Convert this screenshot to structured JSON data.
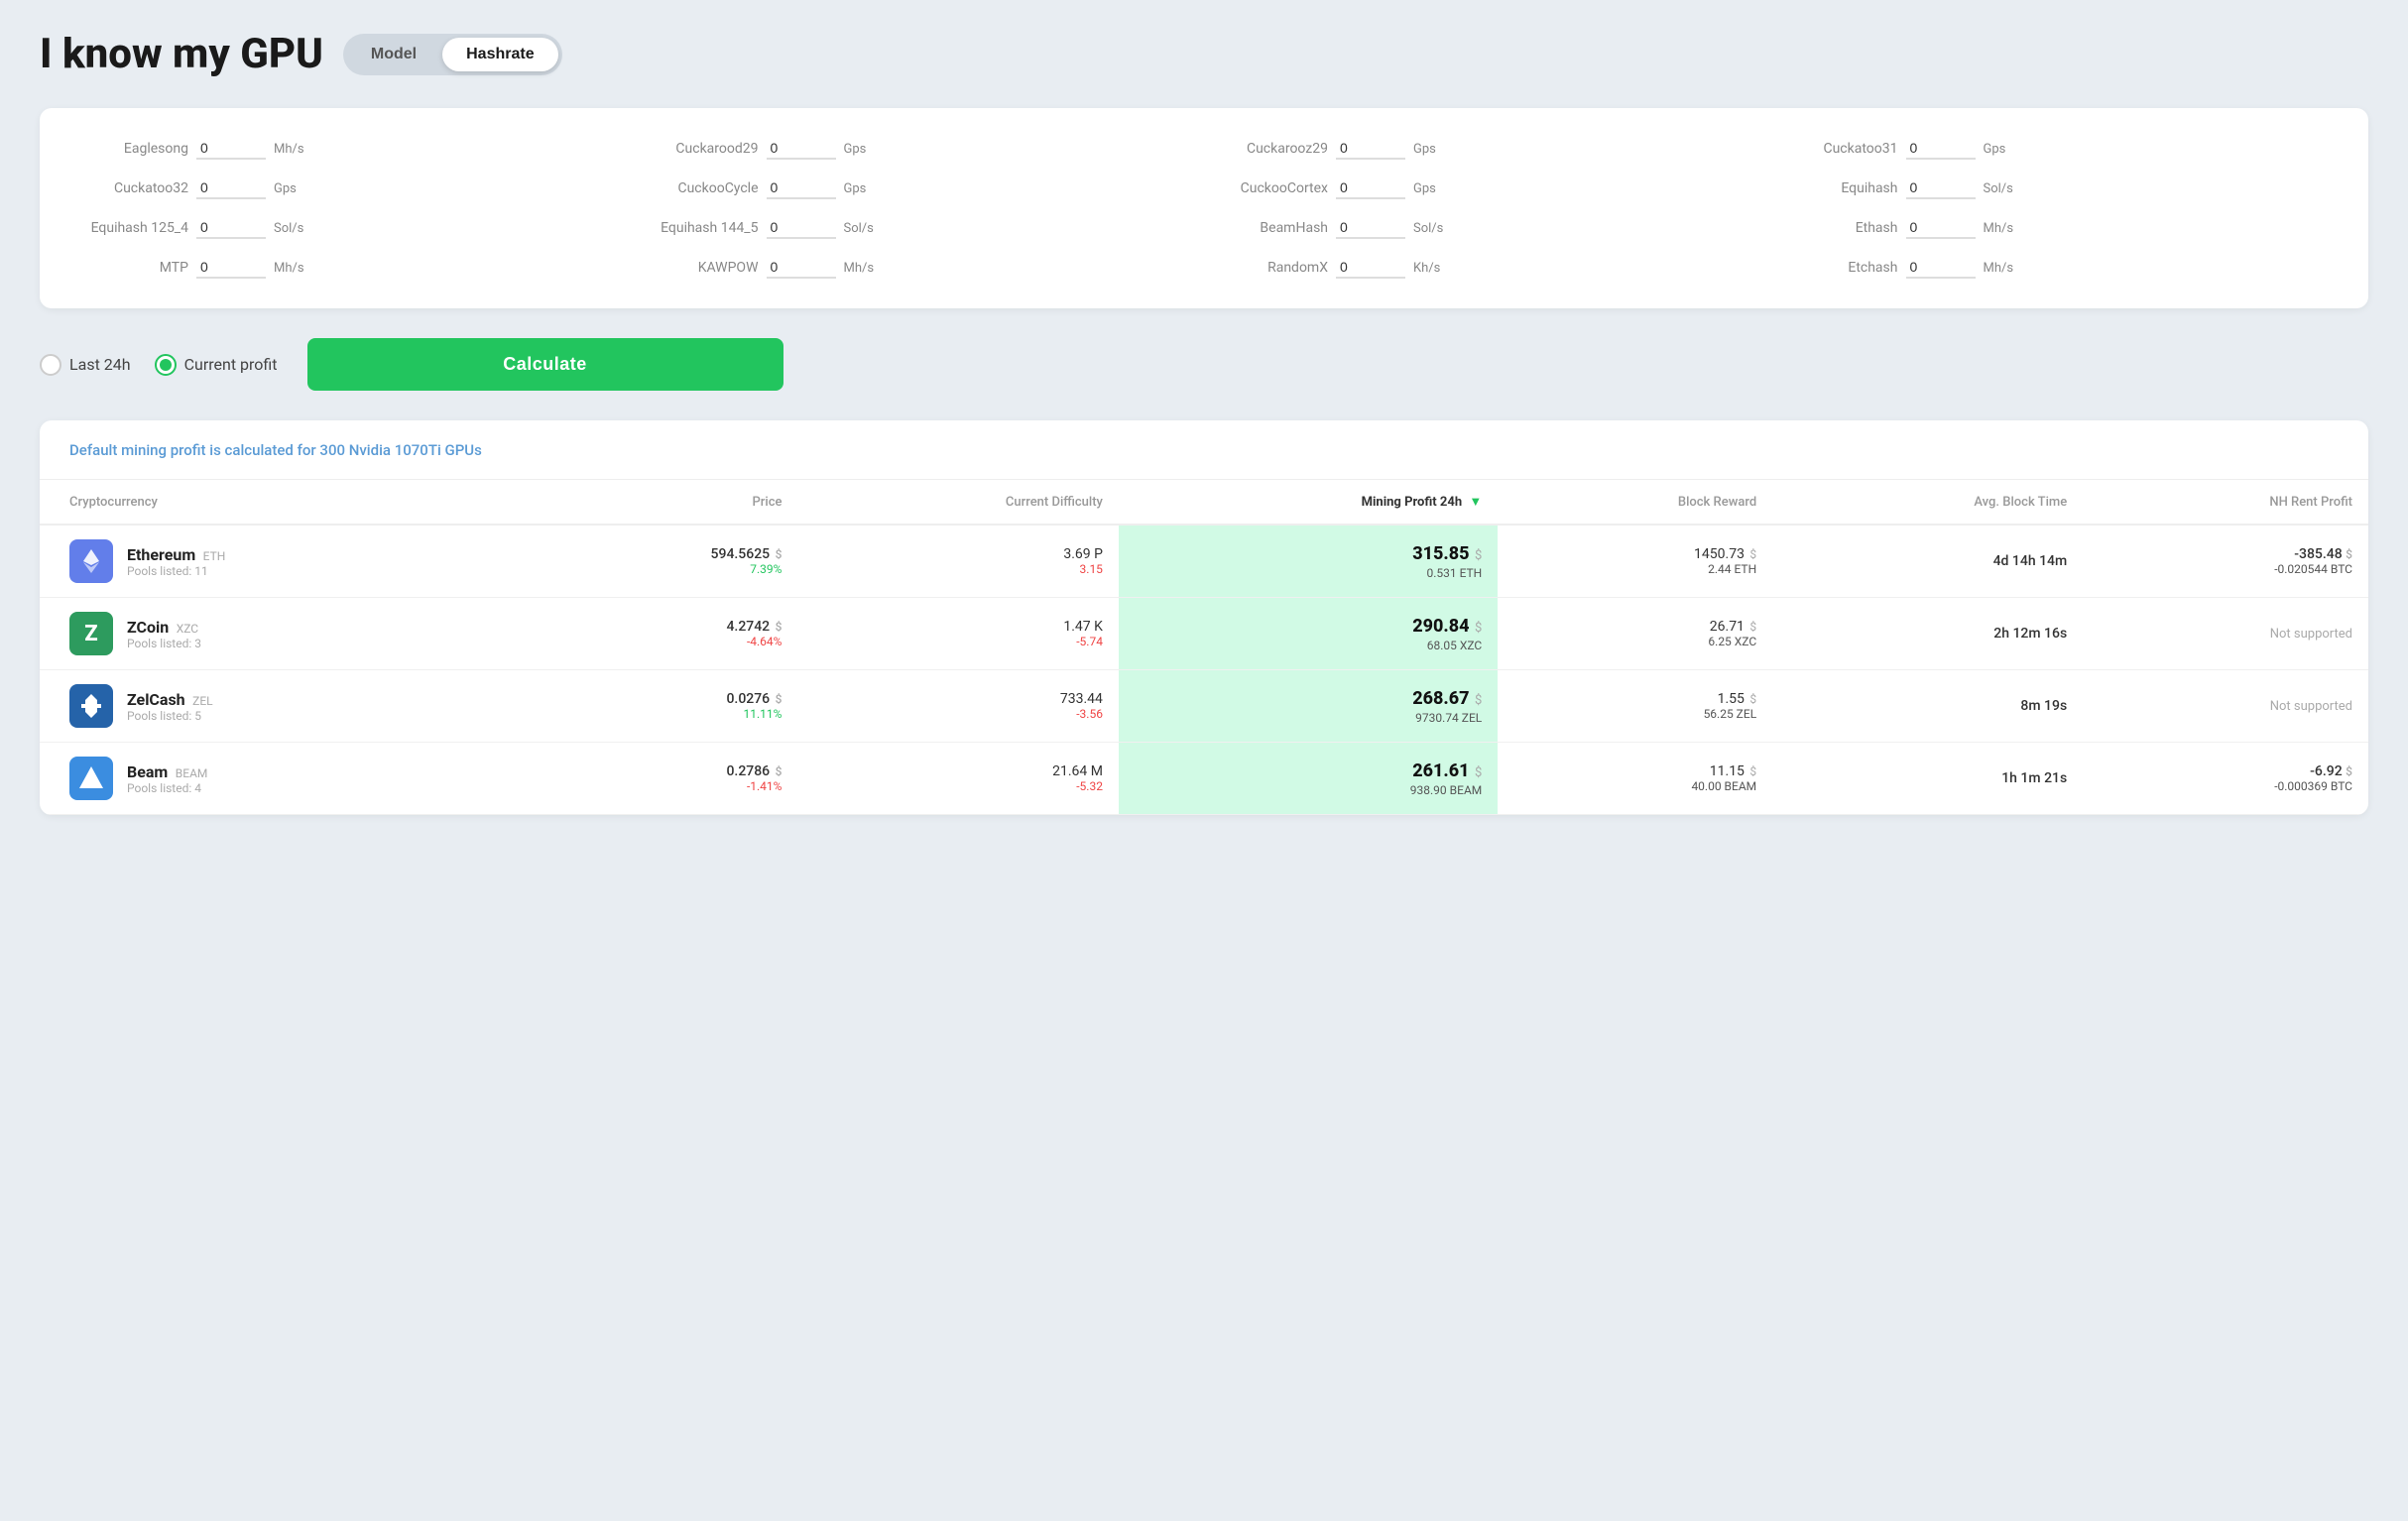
{
  "header": {
    "title": "I know my GPU",
    "toggle": {
      "model_label": "Model",
      "hashrate_label": "Hashrate",
      "active": "hashrate"
    }
  },
  "hashrate_panel": {
    "fields": [
      {
        "label": "Eaglesong",
        "value": "0",
        "unit": "Mh/s"
      },
      {
        "label": "Cuckarood29",
        "value": "0",
        "unit": "Gps"
      },
      {
        "label": "Cuckarooz29",
        "value": "0",
        "unit": "Gps"
      },
      {
        "label": "Cuckatoo31",
        "value": "0",
        "unit": "Gps"
      },
      {
        "label": "Cuckatoo32",
        "value": "0",
        "unit": "Gps"
      },
      {
        "label": "CuckooCycle",
        "value": "0",
        "unit": "Gps"
      },
      {
        "label": "CuckooCortex",
        "value": "0",
        "unit": "Gps"
      },
      {
        "label": "Equihash",
        "value": "0",
        "unit": "Sol/s"
      },
      {
        "label": "Equihash 125_4",
        "value": "0",
        "unit": "Sol/s"
      },
      {
        "label": "Equihash 144_5",
        "value": "0",
        "unit": "Sol/s"
      },
      {
        "label": "BeamHash",
        "value": "0",
        "unit": "Sol/s"
      },
      {
        "label": "Ethash",
        "value": "0",
        "unit": "Mh/s"
      },
      {
        "label": "MTP",
        "value": "0",
        "unit": "Mh/s"
      },
      {
        "label": "KAWPOW",
        "value": "0",
        "unit": "Mh/s"
      },
      {
        "label": "RandomX",
        "value": "0",
        "unit": "Kh/s"
      },
      {
        "label": "Etchash",
        "value": "0",
        "unit": "Mh/s"
      }
    ]
  },
  "controls": {
    "last24h_label": "Last 24h",
    "current_profit_label": "Current profit",
    "selected": "current_profit",
    "calculate_label": "Calculate"
  },
  "results": {
    "info_text": "Default mining profit is calculated for 300 Nvidia 1070Ti GPUs",
    "columns": {
      "cryptocurrency": "Cryptocurrency",
      "price": "Price",
      "current_difficulty": "Current Difficulty",
      "mining_profit": "Mining Profit 24h",
      "block_reward": "Block Reward",
      "avg_block_time": "Avg. Block Time",
      "nh_rent_profit": "NH Rent Profit"
    },
    "rows": [
      {
        "icon": "♦",
        "icon_bg": "#627EEA",
        "icon_color": "white",
        "name": "Ethereum",
        "ticker": "ETH",
        "pools": "Pools listed: 11",
        "price_main": "594.5625",
        "price_pct": "7.39%",
        "price_pct_positive": true,
        "diff_main": "3.69 P",
        "diff_sub": "3.15",
        "diff_sub_negative": true,
        "profit_main": "315.85",
        "profit_sub": "0.531 ETH",
        "reward_main": "1450.73",
        "reward_sub": "2.44 ETH",
        "block_time": "4d 14h 14m",
        "nh_main": "-385.48",
        "nh_sub": "-0.020544 BTC",
        "nh_positive": false,
        "not_supported": false
      },
      {
        "icon": "Z",
        "icon_bg": "#2D9B5E",
        "icon_color": "white",
        "name": "ZCoin",
        "ticker": "XZC",
        "pools": "Pools listed: 3",
        "price_main": "4.2742",
        "price_pct": "-4.64%",
        "price_pct_positive": false,
        "diff_main": "1.47 K",
        "diff_sub": "-5.74",
        "diff_sub_negative": true,
        "profit_main": "290.84",
        "profit_sub": "68.05 XZC",
        "reward_main": "26.71",
        "reward_sub": "6.25 XZC",
        "block_time": "2h 12m 16s",
        "nh_main": "",
        "nh_sub": "",
        "nh_positive": false,
        "not_supported": true
      },
      {
        "icon": "⬡",
        "icon_bg": "#2563A9",
        "icon_color": "white",
        "name": "ZelCash",
        "ticker": "ZEL",
        "pools": "Pools listed: 5",
        "price_main": "0.0276",
        "price_pct": "11.11%",
        "price_pct_positive": true,
        "diff_main": "733.44",
        "diff_sub": "-3.56",
        "diff_sub_negative": true,
        "profit_main": "268.67",
        "profit_sub": "9730.74 ZEL",
        "reward_main": "1.55",
        "reward_sub": "56.25 ZEL",
        "block_time": "8m 19s",
        "nh_main": "",
        "nh_sub": "",
        "nh_positive": false,
        "not_supported": true
      },
      {
        "icon": "▲",
        "icon_bg": "#3B8DE0",
        "icon_color": "white",
        "name": "Beam",
        "ticker": "BEAM",
        "pools": "Pools listed: 4",
        "price_main": "0.2786",
        "price_pct": "-1.41%",
        "price_pct_positive": false,
        "diff_main": "21.64 M",
        "diff_sub": "-5.32",
        "diff_sub_negative": true,
        "profit_main": "261.61",
        "profit_sub": "938.90 BEAM",
        "reward_main": "11.15",
        "reward_sub": "40.00 BEAM",
        "block_time": "1h 1m 21s",
        "nh_main": "-6.92",
        "nh_sub": "-0.000369 BTC",
        "nh_positive": false,
        "not_supported": false
      }
    ]
  }
}
